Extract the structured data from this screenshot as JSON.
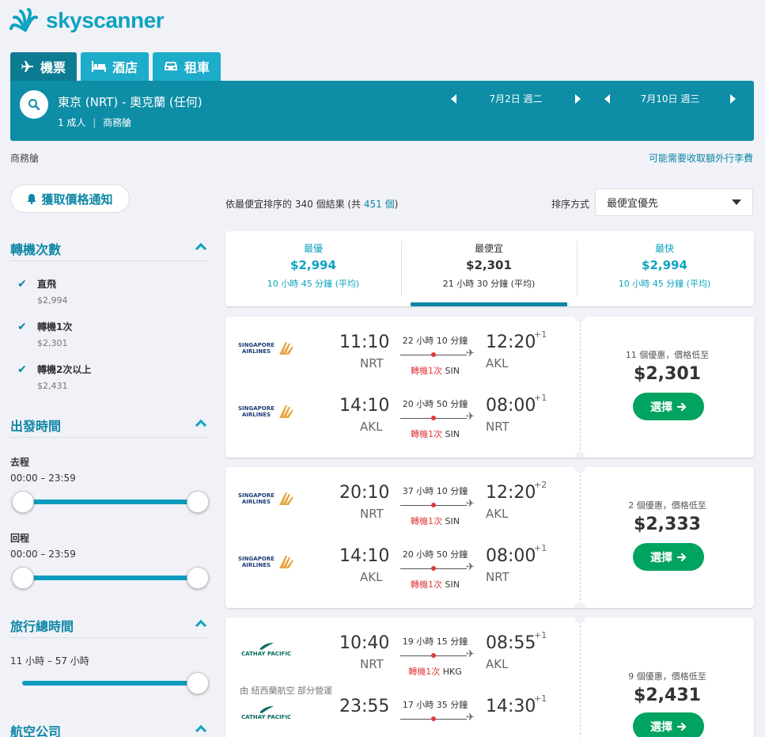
{
  "brand": {
    "name": "skyscanner"
  },
  "tabs": [
    {
      "label": "機票",
      "icon": "plane-icon"
    },
    {
      "label": "酒店",
      "icon": "bed-icon"
    },
    {
      "label": "租車",
      "icon": "car-icon"
    }
  ],
  "search": {
    "route": "東京 (NRT) - 奧克蘭 (任何)",
    "pax": "1 成人",
    "cabin": "商務艙",
    "depart_date": "7月2日 週二",
    "return_date": "7月10日 週三"
  },
  "cabin_label": "商務艙",
  "bag_fee_link": "可能需要收取額外行李費",
  "price_alert": "獲取價格通知",
  "filters": {
    "stops": {
      "title": "轉機次數",
      "items": [
        {
          "label": "直飛",
          "price": "$2,994",
          "checked": true
        },
        {
          "label": "轉機1次",
          "price": "$2,301",
          "checked": true
        },
        {
          "label": "轉機2次以上",
          "price": "$2,431",
          "checked": true
        }
      ]
    },
    "depart_time": {
      "title": "出發時間",
      "outbound_label": "去程",
      "outbound_range": "00:00 – 23:59",
      "return_label": "回程",
      "return_range": "00:00 – 23:59"
    },
    "duration": {
      "title": "旅行總時間",
      "range": "11 小時 – 57 小時"
    },
    "airlines": {
      "title": "航空公司"
    }
  },
  "results": {
    "prefix": "依",
    "sort_word": "最便宜",
    "middle": "排序的 340 個結果 (共 ",
    "total_link": "451 個",
    "suffix": ")"
  },
  "sort": {
    "label": "排序方式",
    "value": "最便宜優先"
  },
  "sort_tabs": [
    {
      "title": "最優",
      "price": "$2,994",
      "duration": "10 小時 45 分鐘 (平均)"
    },
    {
      "title": "最便宜",
      "price": "$2,301",
      "duration": "21 小時 30 分鐘 (平均)"
    },
    {
      "title": "最快",
      "price": "$2,994",
      "duration": "10 小時 45 分鐘 (平均)"
    }
  ],
  "cards": [
    {
      "legs": [
        {
          "airline": "SINGAPORE AIRLINES",
          "dep": "11:10",
          "dep_code": "NRT",
          "dur": "22 小時 10 分鐘",
          "stops": "轉機1次",
          "via": "SIN",
          "arr": "12:20",
          "plus": "+1",
          "arr_code": "AKL"
        },
        {
          "airline": "SINGAPORE AIRLINES",
          "dep": "14:10",
          "dep_code": "AKL",
          "dur": "20 小時 50 分鐘",
          "stops": "轉機1次",
          "via": "SIN",
          "arr": "08:00",
          "plus": "+1",
          "arr_code": "NRT"
        }
      ],
      "deal": "11 個優惠，價格低至",
      "price": "$2,301",
      "button": "選擇"
    },
    {
      "legs": [
        {
          "airline": "SINGAPORE AIRLINES",
          "dep": "20:10",
          "dep_code": "NRT",
          "dur": "37 小時 10 分鐘",
          "stops": "轉機1次",
          "via": "SIN",
          "arr": "12:20",
          "plus": "+2",
          "arr_code": "AKL"
        },
        {
          "airline": "SINGAPORE AIRLINES",
          "dep": "14:10",
          "dep_code": "AKL",
          "dur": "20 小時 50 分鐘",
          "stops": "轉機1次",
          "via": "SIN",
          "arr": "08:00",
          "plus": "+1",
          "arr_code": "NRT"
        }
      ],
      "deal": "2 個優惠，價格低至",
      "price": "$2,333",
      "button": "選擇"
    },
    {
      "legs": [
        {
          "airline": "CATHAY PACIFIC",
          "dep": "10:40",
          "dep_code": "NRT",
          "dur": "19 小時 15 分鐘",
          "stops": "轉機1次",
          "via": "HKG",
          "arr": "08:55",
          "plus": "+1",
          "arr_code": "AKL",
          "note": "由 紐西蘭航空 部分營運"
        },
        {
          "airline": "CATHAY PACIFIC",
          "dep": "23:55",
          "dep_code": "",
          "dur": "17 小時 35 分鐘",
          "stops": "",
          "via": "",
          "arr": "14:30",
          "plus": "+1",
          "arr_code": ""
        }
      ],
      "deal": "9 個優惠，價格低至",
      "price": "$2,431",
      "button": "選擇"
    }
  ],
  "colors": {
    "brand": "#0fa3c0",
    "header": "#0d8da6",
    "select_button": "#00a35f",
    "stop_red": "#e0393e",
    "singapore_gold": "#e7a33b"
  }
}
